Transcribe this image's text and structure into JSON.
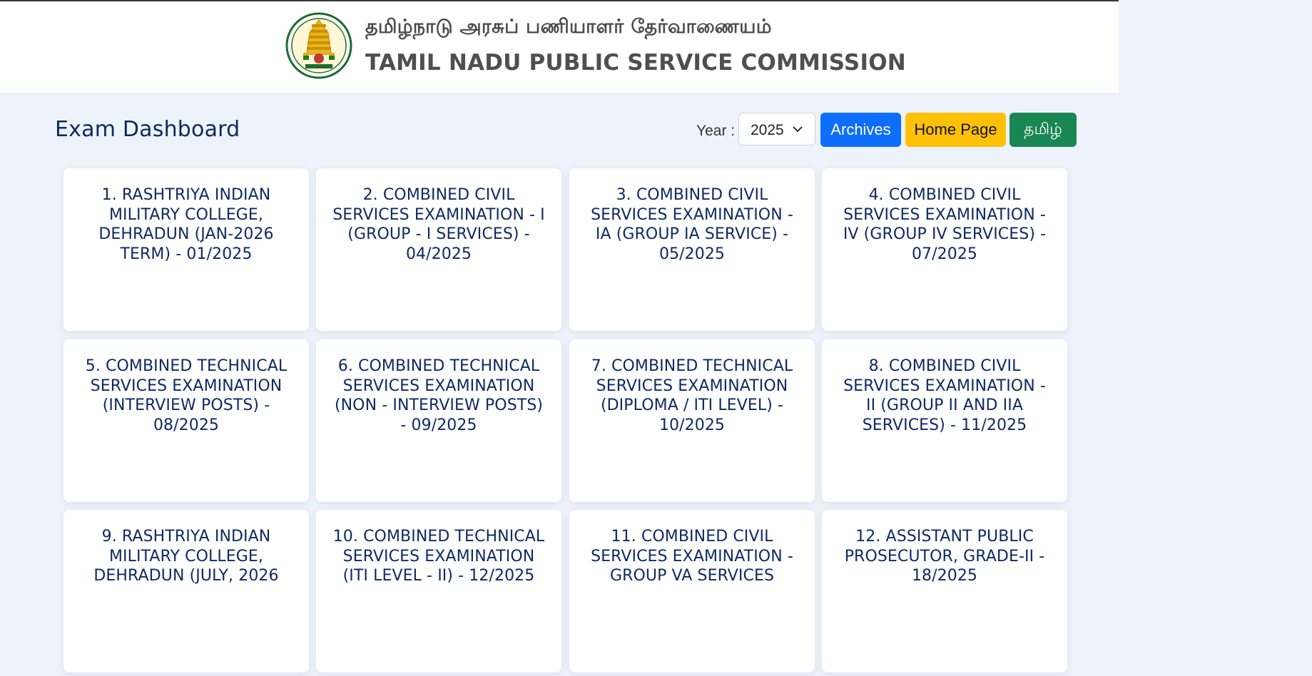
{
  "header": {
    "tamil_title": "தமிழ்நாடு அரசுப் பணியாளர் தேர்வாணையம்",
    "english_title": "TAMIL NADU PUBLIC SERVICE COMMISSION"
  },
  "toolbar": {
    "title": "Exam Dashboard",
    "year_label": "Year :",
    "year_value": "2025",
    "archives_label": "Archives",
    "home_label": "Home Page",
    "tamil_label": "தமிழ்"
  },
  "exams": [
    {
      "label": "1. RASHTRIYA INDIAN MILITARY COLLEGE, DEHRADUN (JAN-2026 TERM) - 01/2025"
    },
    {
      "label": "2. COMBINED CIVIL SERVICES EXAMINATION - I (GROUP - I SERVICES) - 04/2025"
    },
    {
      "label": "3. COMBINED CIVIL SERVICES EXAMINATION - IA (GROUP IA SERVICE) - 05/2025"
    },
    {
      "label": "4. COMBINED CIVIL SERVICES EXAMINATION - IV (GROUP IV SERVICES) - 07/2025"
    },
    {
      "label": "5. COMBINED TECHNICAL SERVICES EXAMINATION (INTERVIEW POSTS) - 08/2025"
    },
    {
      "label": "6. COMBINED TECHNICAL SERVICES EXAMINATION (NON - INTERVIEW POSTS) - 09/2025"
    },
    {
      "label": "7. COMBINED TECHNICAL SERVICES EXAMINATION (DIPLOMA / ITI LEVEL) - 10/2025"
    },
    {
      "label": "8. COMBINED CIVIL SERVICES EXAMINATION - II (GROUP II AND IIA SERVICES) - 11/2025"
    },
    {
      "label": "9. RASHTRIYA INDIAN MILITARY COLLEGE, DEHRADUN (JULY, 2026"
    },
    {
      "label": "10. COMBINED TECHNICAL SERVICES EXAMINATION (ITI LEVEL - II) - 12/2025"
    },
    {
      "label": "11. COMBINED CIVIL SERVICES EXAMINATION - GROUP VA SERVICES"
    },
    {
      "label": "12. ASSISTANT PUBLIC PROSECUTOR, GRADE-II - 18/2025"
    }
  ],
  "colors": {
    "brand_blue": "#0e2a63",
    "archives": "#0d6efd",
    "home": "#ffc107",
    "tamil": "#198754"
  }
}
